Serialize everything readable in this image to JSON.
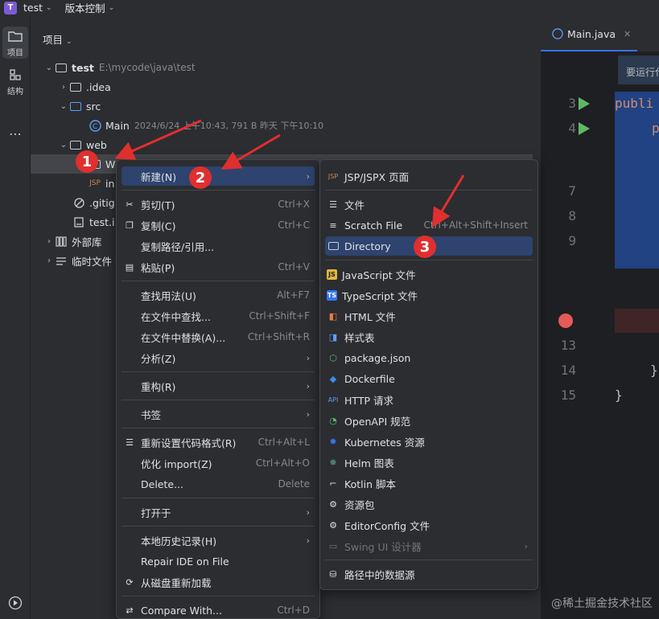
{
  "titlebar": {
    "badge": "T",
    "project": "test",
    "vcs": "版本控制"
  },
  "strip": {
    "project_label": "项目",
    "structure_label": "结构",
    "more": "⋯"
  },
  "panel": {
    "header": "项目",
    "tree": {
      "root": {
        "name": "test",
        "path": "E:\\mycode\\java\\test"
      },
      "idea": ".idea",
      "src": "src",
      "main": {
        "name": "Main",
        "meta": "2024/6/24 上午10:43, 791 B 昨天 下午10:10"
      },
      "web": "web",
      "webinf": "W",
      "index": "in",
      "gitignore": ".gitig",
      "testiml": "test.i",
      "extlib": "外部库",
      "scratch": "临时文件"
    }
  },
  "editor": {
    "tab": "Main.java",
    "banner": "要运行代码",
    "lines": [
      "3",
      "4",
      "7",
      "8",
      "9",
      "13",
      "14",
      "15"
    ],
    "code": {
      "public": "publi",
      "p": "p",
      "brace1": "}",
      "brace2": "}"
    }
  },
  "menu1": {
    "items": [
      {
        "label": "新建(N)"
      },
      {
        "label": "剪切(T)",
        "sc": "Ctrl+X"
      },
      {
        "label": "复制(C)",
        "sc": "Ctrl+C"
      },
      {
        "label": "复制路径/引用..."
      },
      {
        "label": "粘贴(P)",
        "sc": "Ctrl+V"
      },
      {
        "label": "查找用法(U)",
        "sc": "Alt+F7"
      },
      {
        "label": "在文件中查找...",
        "sc": "Ctrl+Shift+F"
      },
      {
        "label": "在文件中替换(A)...",
        "sc": "Ctrl+Shift+R"
      },
      {
        "label": "分析(Z)"
      },
      {
        "label": "重构(R)"
      },
      {
        "label": "书签"
      },
      {
        "label": "重新设置代码格式(R)",
        "sc": "Ctrl+Alt+L"
      },
      {
        "label": "优化 import(Z)",
        "sc": "Ctrl+Alt+O"
      },
      {
        "label": "Delete...",
        "sc": "Delete"
      },
      {
        "label": "打开于"
      },
      {
        "label": "本地历史记录(H)"
      },
      {
        "label": "Repair IDE on File"
      },
      {
        "label": "从磁盘重新加载"
      },
      {
        "label": "Compare With...",
        "sc": "Ctrl+D"
      }
    ]
  },
  "menu2": {
    "items": [
      {
        "label": "JSP/JSPX 页面"
      },
      {
        "label": "文件"
      },
      {
        "label": "Scratch File",
        "sc": "Ctrl+Alt+Shift+Insert"
      },
      {
        "label": "Directory"
      },
      {
        "label": "JavaScript 文件"
      },
      {
        "label": "TypeScript 文件"
      },
      {
        "label": "HTML 文件"
      },
      {
        "label": "样式表"
      },
      {
        "label": "package.json"
      },
      {
        "label": "Dockerfile"
      },
      {
        "label": "HTTP 请求"
      },
      {
        "label": "OpenAPI 规范"
      },
      {
        "label": "Kubernetes 资源"
      },
      {
        "label": "Helm 图表"
      },
      {
        "label": "Kotlin 脚本"
      },
      {
        "label": "资源包"
      },
      {
        "label": "EditorConfig 文件"
      },
      {
        "label": "Swing UI 设计器"
      },
      {
        "label": "路径中的数据源"
      }
    ]
  },
  "badges": [
    "1",
    "2",
    "3"
  ],
  "watermark": "@稀土掘金技术社区"
}
